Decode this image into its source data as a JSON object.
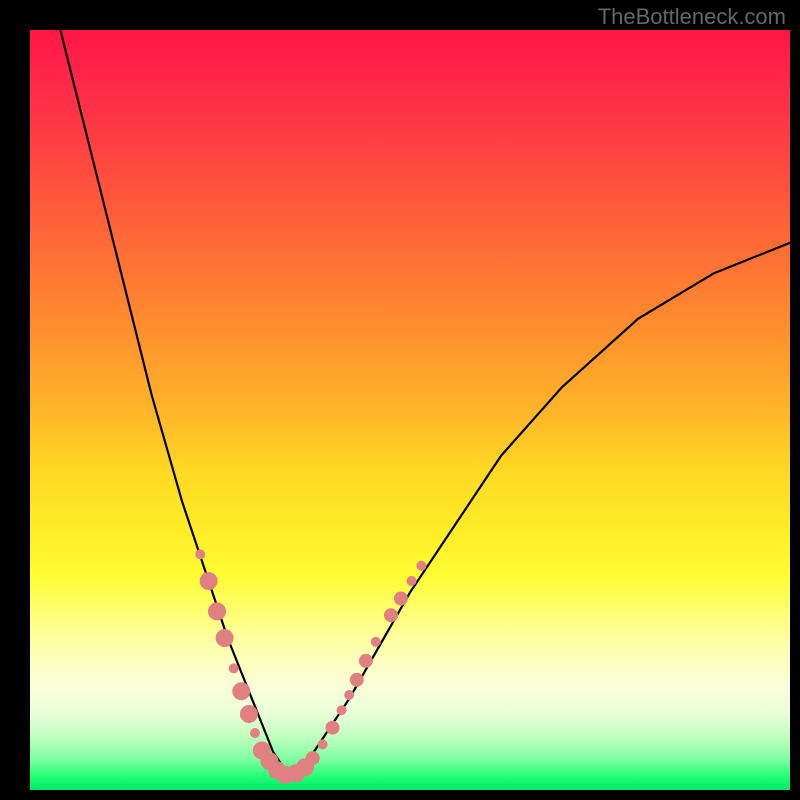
{
  "watermark": "TheBottleneck.com",
  "chart_data": {
    "type": "line",
    "title": "",
    "xlabel": "",
    "ylabel": "",
    "xlim": [
      0,
      100
    ],
    "ylim": [
      0,
      100
    ],
    "series": [
      {
        "name": "curve",
        "description": "V-shaped bottleneck curve; minimum near x≈34",
        "x": [
          4,
          6,
          8,
          10,
          12,
          14,
          16,
          18,
          20,
          22,
          24,
          26,
          28,
          30,
          32,
          34,
          36,
          38,
          42,
          46,
          50,
          56,
          62,
          70,
          80,
          90,
          100
        ],
        "y": [
          100,
          92,
          84,
          76,
          68,
          60,
          52,
          45,
          38,
          32,
          26,
          20,
          15,
          10,
          5,
          2,
          3,
          6,
          12,
          19,
          26,
          35,
          44,
          53,
          62,
          68,
          72
        ]
      }
    ],
    "markers": {
      "description": "Salmon-colored point markers along the lower portion of both branches of the V",
      "color": "#e08080",
      "points": [
        {
          "x": 22.4,
          "y": 31.0,
          "r": 5
        },
        {
          "x": 23.5,
          "y": 27.5,
          "r": 9
        },
        {
          "x": 24.6,
          "y": 23.5,
          "r": 9
        },
        {
          "x": 25.6,
          "y": 20.0,
          "r": 9
        },
        {
          "x": 26.8,
          "y": 16.0,
          "r": 5
        },
        {
          "x": 27.8,
          "y": 13.0,
          "r": 9
        },
        {
          "x": 28.8,
          "y": 10.0,
          "r": 9
        },
        {
          "x": 29.6,
          "y": 7.5,
          "r": 5
        },
        {
          "x": 30.5,
          "y": 5.2,
          "r": 9
        },
        {
          "x": 31.5,
          "y": 3.8,
          "r": 9
        },
        {
          "x": 32.5,
          "y": 2.6,
          "r": 9
        },
        {
          "x": 33.6,
          "y": 2.0,
          "r": 9
        },
        {
          "x": 35.0,
          "y": 2.2,
          "r": 9
        },
        {
          "x": 36.2,
          "y": 3.0,
          "r": 9
        },
        {
          "x": 37.2,
          "y": 4.2,
          "r": 7
        },
        {
          "x": 38.5,
          "y": 6.0,
          "r": 5
        },
        {
          "x": 39.8,
          "y": 8.2,
          "r": 7
        },
        {
          "x": 41.0,
          "y": 10.5,
          "r": 5
        },
        {
          "x": 42.0,
          "y": 12.5,
          "r": 5
        },
        {
          "x": 43.0,
          "y": 14.5,
          "r": 7
        },
        {
          "x": 44.2,
          "y": 17.0,
          "r": 7
        },
        {
          "x": 45.5,
          "y": 19.5,
          "r": 5
        },
        {
          "x": 47.5,
          "y": 23.0,
          "r": 7
        },
        {
          "x": 48.8,
          "y": 25.2,
          "r": 7
        },
        {
          "x": 50.2,
          "y": 27.5,
          "r": 5
        },
        {
          "x": 51.5,
          "y": 29.5,
          "r": 5
        }
      ]
    }
  }
}
